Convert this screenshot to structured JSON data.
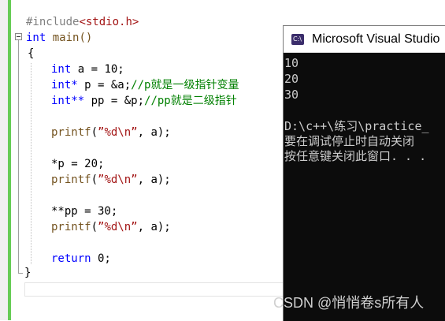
{
  "editor": {
    "lines": {
      "include_directive": "#include",
      "include_header": "<stdio.h>",
      "main_type": "int",
      "main_name": "main()",
      "open_brace": "{",
      "l_a_type": "int",
      "l_a_rest": " a = 10;",
      "l_p_type": "int*",
      "l_p_rest": " p = &a;",
      "l_p_comment": "//p就是一级指针变量",
      "l_pp_type": "int**",
      "l_pp_rest": " pp = &p;",
      "l_pp_comment": "//pp就是二级指针",
      "printf1_name": "printf",
      "printf1_open": "(",
      "printf1_str": "”%d\\n”",
      "printf1_rest": ", a);",
      "assign_p": "*p = 20;",
      "printf2_name": "printf",
      "printf2_open": "(",
      "printf2_str": "”%d\\n”",
      "printf2_rest": ", a);",
      "assign_pp": "**pp = 30;",
      "printf3_name": "printf",
      "printf3_open": "(",
      "printf3_str": "”%d\\n”",
      "printf3_rest": ", a);",
      "return_kw": "return",
      "return_rest": " 0;",
      "close_brace": "}"
    }
  },
  "console": {
    "title": "Microsoft Visual Studio",
    "icon_label": "C:\\",
    "output": [
      "10",
      "20",
      "30",
      "",
      "D:\\c++\\练习\\practice_",
      "要在调试停止时自动关闭",
      "按任意键关闭此窗口. . ."
    ]
  },
  "watermark": "CSDN @悄悄卷s所有人"
}
